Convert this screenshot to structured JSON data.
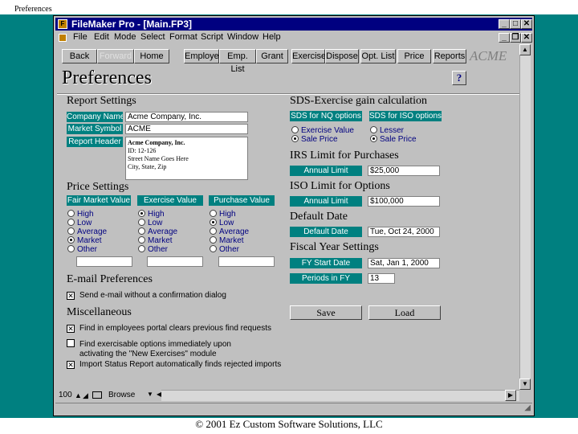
{
  "slide_title": "Preferences",
  "footer": "© 2001 Ez Custom Software Solutions, LLC",
  "window": {
    "title": "FileMaker Pro - [Main.FP3]"
  },
  "menu": [
    "File",
    "Edit",
    "Mode",
    "Select",
    "Format",
    "Script",
    "Window",
    "Help"
  ],
  "nav": {
    "left": [
      "Back",
      "Forward",
      "Home"
    ],
    "right": [
      "Employee",
      "Emp. List",
      "Grant",
      "Exercise",
      "Dispose",
      "Opt. List",
      "Price",
      "Reports"
    ],
    "logo": "ACME"
  },
  "page_title": "Preferences",
  "help_label": "?",
  "report_settings": {
    "heading": "Report Settings",
    "company_name_label": "Company Name",
    "company_name": "Acme Company, Inc.",
    "market_symbol_label": "Market Symbol",
    "market_symbol": "ACME",
    "report_header_label": "Report Header",
    "report_header_lines": [
      "Acme Company, Inc.",
      "ID: 12-126",
      "Street Name Goes Here",
      "City, State, Zip"
    ]
  },
  "price_settings": {
    "heading": "Price Settings",
    "groups": [
      {
        "label": "Fair Market Value",
        "options": [
          "High",
          "Low",
          "Average",
          "Market",
          "Other"
        ],
        "selected": "Market"
      },
      {
        "label": "Exercise Value",
        "options": [
          "High",
          "Low",
          "Average",
          "Market",
          "Other"
        ],
        "selected": "High"
      },
      {
        "label": "Purchase Value",
        "options": [
          "High",
          "Low",
          "Average",
          "Market",
          "Other"
        ],
        "selected": "Low"
      }
    ]
  },
  "email": {
    "heading": "E-mail Preferences",
    "send_label": "Send e-mail without a confirmation dialog",
    "send_checked": true
  },
  "misc": {
    "heading": "Miscellaneous",
    "items": [
      {
        "lines": [
          "Find in employees portal clears previous find requests"
        ],
        "checked": true
      },
      {
        "lines": [
          "Find exercisable options immediately upon",
          "activating the \"New Exercises\" module"
        ],
        "checked": false
      },
      {
        "lines": [
          "Import Status Report automatically finds rejected imports"
        ],
        "checked": true
      }
    ]
  },
  "sds": {
    "heading": "SDS-Exercise gain calculation",
    "nq_label": "SDS for NQ options",
    "iso_label": "SDS for ISO options",
    "nq_options": [
      "Exercise Value",
      "Sale Price"
    ],
    "nq_selected": "Sale Price",
    "iso_options": [
      "Lesser",
      "Sale Price"
    ],
    "iso_selected": "Sale Price"
  },
  "irs": {
    "heading": "IRS Limit for Purchases",
    "label": "Annual Limit",
    "value": "$25,000"
  },
  "iso": {
    "heading": "ISO Limit for Options",
    "label": "Annual Limit",
    "value": "$100,000"
  },
  "default_date": {
    "heading": "Default Date",
    "label": "Default Date",
    "value": "Tue, Oct 24, 2000"
  },
  "fiscal": {
    "heading": "Fiscal Year Settings",
    "start_label": "FY Start Date",
    "start_value": "Sat, Jan 1, 2000",
    "periods_label": "Periods in FY",
    "periods_value": "13"
  },
  "buttons": {
    "save": "Save",
    "load": "Load"
  },
  "status": {
    "zoom": "100",
    "mode": "Browse"
  }
}
